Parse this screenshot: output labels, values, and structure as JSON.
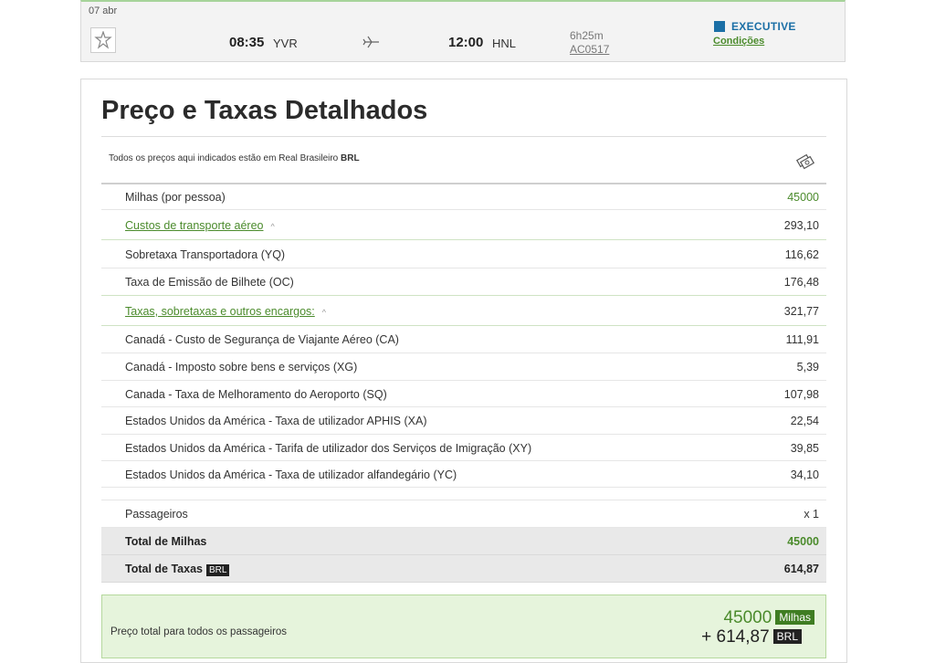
{
  "flight": {
    "date": "07 abr",
    "departure_time": "08:35",
    "departure_airport": "YVR",
    "arrival_time": "12:00",
    "arrival_airport": "HNL",
    "duration": "6h25m",
    "flight_number": "AC0517",
    "cabin": "EXECUTIVE",
    "conditions_link": "Condições",
    "colors": {
      "cabin": "#1b6fa6",
      "link": "#4b8b2c"
    }
  },
  "details": {
    "title": "Preço e Taxas Detalhados",
    "note_prefix": "Todos os preços aqui indicados estão em Real Brasileiro",
    "note_currency": "BRL",
    "rows": [
      {
        "label": "Milhas (por pessoa)",
        "value": "45000"
      },
      {
        "label": "Custos de transporte aéreo",
        "value": "293,10"
      },
      {
        "label": "Sobretaxa Transportadora (YQ)",
        "value": "116,62"
      },
      {
        "label": "Taxa de Emissão de Bilhete (OC)",
        "value": "176,48"
      },
      {
        "label": "Taxas, sobretaxas e outros encargos:",
        "value": "321,77"
      },
      {
        "label": "Canadá - Custo de Segurança de Viajante Aéreo (CA)",
        "value": "111,91"
      },
      {
        "label": "Canadá - Imposto sobre bens e serviços (XG)",
        "value": "5,39"
      },
      {
        "label": "Canada - Taxa de Melhoramento do Aeroporto (SQ)",
        "value": "107,98"
      },
      {
        "label": "Estados Unidos da América - Taxa de utilizador APHIS (XA)",
        "value": "22,54"
      },
      {
        "label": "Estados Unidos da América - Tarifa de utilizador dos Serviços de Imigração (XY)",
        "value": "39,85"
      },
      {
        "label": "Estados Unidos da América - Taxa de utilizador alfandegário (YC)",
        "value": "34,10"
      }
    ],
    "passengers_label": "Passageiros",
    "passengers_value": "x 1",
    "total_miles_label": "Total de Milhas",
    "total_miles_value": "45000",
    "total_taxes_label": "Total de Taxas",
    "total_taxes_badge": "BRL",
    "total_taxes_value": "614,87"
  },
  "total": {
    "label": "Preço total para todos os passageiros",
    "miles": "45000",
    "miles_tag": "Milhas",
    "money": "+ 614,87",
    "money_tag": "BRL",
    "colors": {
      "background": "#e6f4dc",
      "miles": "#4b8b2c"
    }
  }
}
